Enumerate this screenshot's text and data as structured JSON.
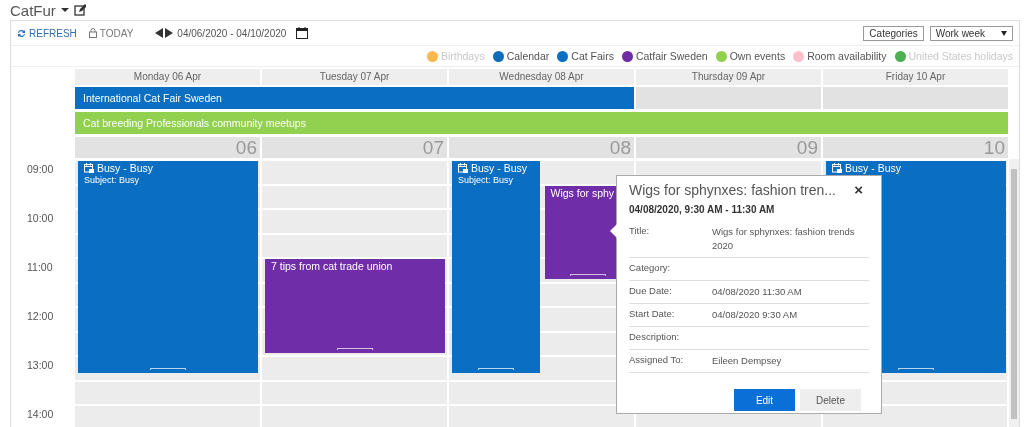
{
  "app": {
    "title": "CatFur"
  },
  "toolbar": {
    "refresh": "REFRESH",
    "today": "TODAY",
    "date_range": "04/06/2020 - 04/10/2020",
    "categories": "Categories",
    "view": "Work week"
  },
  "legend": [
    {
      "label": "Birthdays",
      "color": "#f8b84e",
      "active": false
    },
    {
      "label": "Calendar",
      "color": "#0f6cbd",
      "active": true
    },
    {
      "label": "Cat Fairs",
      "color": "#0a6fc2",
      "active": true
    },
    {
      "label": "Catfair Sweden",
      "color": "#6f2da8",
      "active": true
    },
    {
      "label": "Own events",
      "color": "#92d050",
      "active": true
    },
    {
      "label": "Room availability",
      "color": "#ffc0cb",
      "active": true
    },
    {
      "label": "United States holidays",
      "color": "#4caf50",
      "active": false
    }
  ],
  "all_day_events": [
    {
      "title": "International Cat Fair Sweden",
      "color": "#0a6fc2"
    },
    {
      "title": "Cat breeding Professionals community meetups",
      "color": "#92d050"
    }
  ],
  "hours": [
    "09:00",
    "10:00",
    "11:00",
    "12:00",
    "13:00",
    "14:00"
  ],
  "days": [
    {
      "header": "Monday 06 Apr",
      "number": "06",
      "events": [
        {
          "title": "Busy - Busy",
          "subject": "Subject: Busy",
          "kind": "busy",
          "color": "#0a6fc2"
        }
      ]
    },
    {
      "header": "Tuesday 07 Apr",
      "number": "07",
      "events": [
        {
          "title": "7 tips from cat trade union",
          "kind": "plain",
          "color": "#6f2da8"
        }
      ]
    },
    {
      "header": "Wednesday 08 Apr",
      "number": "08",
      "events": [
        {
          "title": "Busy - Busy",
          "subject": "Subject: Busy",
          "kind": "busy",
          "color": "#0a6fc2"
        },
        {
          "title": "Wigs for sphy",
          "kind": "plain",
          "color": "#6f2da8"
        }
      ]
    },
    {
      "header": "Thursday 09 Apr",
      "number": "09"
    },
    {
      "header": "Friday 10 Apr",
      "number": "10",
      "events": [
        {
          "title": "Busy - Busy",
          "kind": "busy",
          "color": "#0a6fc2"
        }
      ]
    }
  ],
  "popup": {
    "title": "Wigs for sphynxes: fashion tren...",
    "close": "×",
    "datetime": "04/08/2020, 9:30 AM - 11:30 AM",
    "fields": [
      {
        "label": "Title:",
        "value": "Wigs for sphynxes: fashion trends 2020"
      },
      {
        "label": "Category:"
      },
      {
        "label": "Due Date:",
        "value": "04/08/2020 11:30 AM"
      },
      {
        "label": "Start Date:",
        "value": "04/08/2020 9:30 AM"
      },
      {
        "label": "Description:"
      },
      {
        "label": "Assigned To:",
        "value": "Eileen Dempsey"
      }
    ],
    "buttons": [
      {
        "label": "Edit",
        "kind": "primary"
      },
      {
        "label": "Delete",
        "kind": "secondary"
      }
    ]
  }
}
